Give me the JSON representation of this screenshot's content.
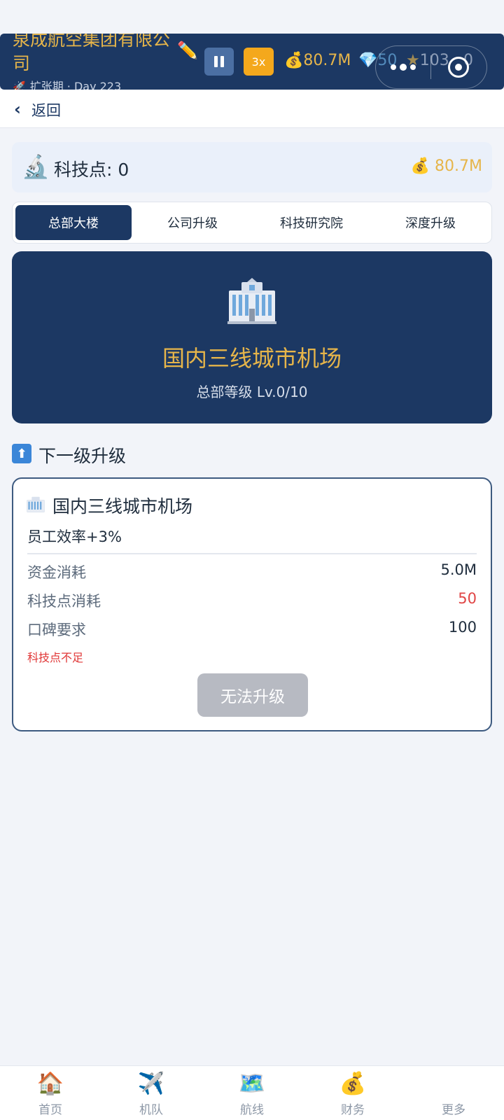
{
  "header": {
    "company_name": "泉成航空集团有限公司",
    "stage": "扩张期 · Day 223",
    "speed": "3x",
    "money": "80.7M",
    "gems": "50",
    "reputation": "103",
    "tech": "0"
  },
  "nav_bar": {
    "back_label": "返回"
  },
  "tech_card": {
    "label": "科技点: 0",
    "money": "80.7M"
  },
  "tabs": [
    {
      "label": "总部大楼",
      "active": true
    },
    {
      "label": "公司升级",
      "active": false
    },
    {
      "label": "科技研究院",
      "active": false
    },
    {
      "label": "深度升级",
      "active": false
    }
  ],
  "hero": {
    "title": "国内三线城市机场",
    "level": "总部等级 Lv.0/10"
  },
  "next_section": {
    "heading": "下一级升级",
    "card": {
      "title": "国内三线城市机场",
      "effect": "员工效率+3%",
      "costs": [
        {
          "label": "资金消耗",
          "value": "5.0M"
        },
        {
          "label": "科技点消耗",
          "value": "50"
        },
        {
          "label": "口碑要求",
          "value": "100"
        }
      ],
      "warning": "科技点不足",
      "button_label": "无法升级"
    }
  },
  "bottom_nav": [
    {
      "label": "首页",
      "icon": "house-icon"
    },
    {
      "label": "机队",
      "icon": "airplane-icon"
    },
    {
      "label": "航线",
      "icon": "map-icon"
    },
    {
      "label": "财务",
      "icon": "money-bag-icon"
    },
    {
      "label": "更多",
      "icon": "more-icon"
    }
  ],
  "colors": {
    "navy": "#1c3863",
    "gold": "#e6b54a",
    "warning_red": "#e03535",
    "disabled_gray": "#b7bac2"
  }
}
